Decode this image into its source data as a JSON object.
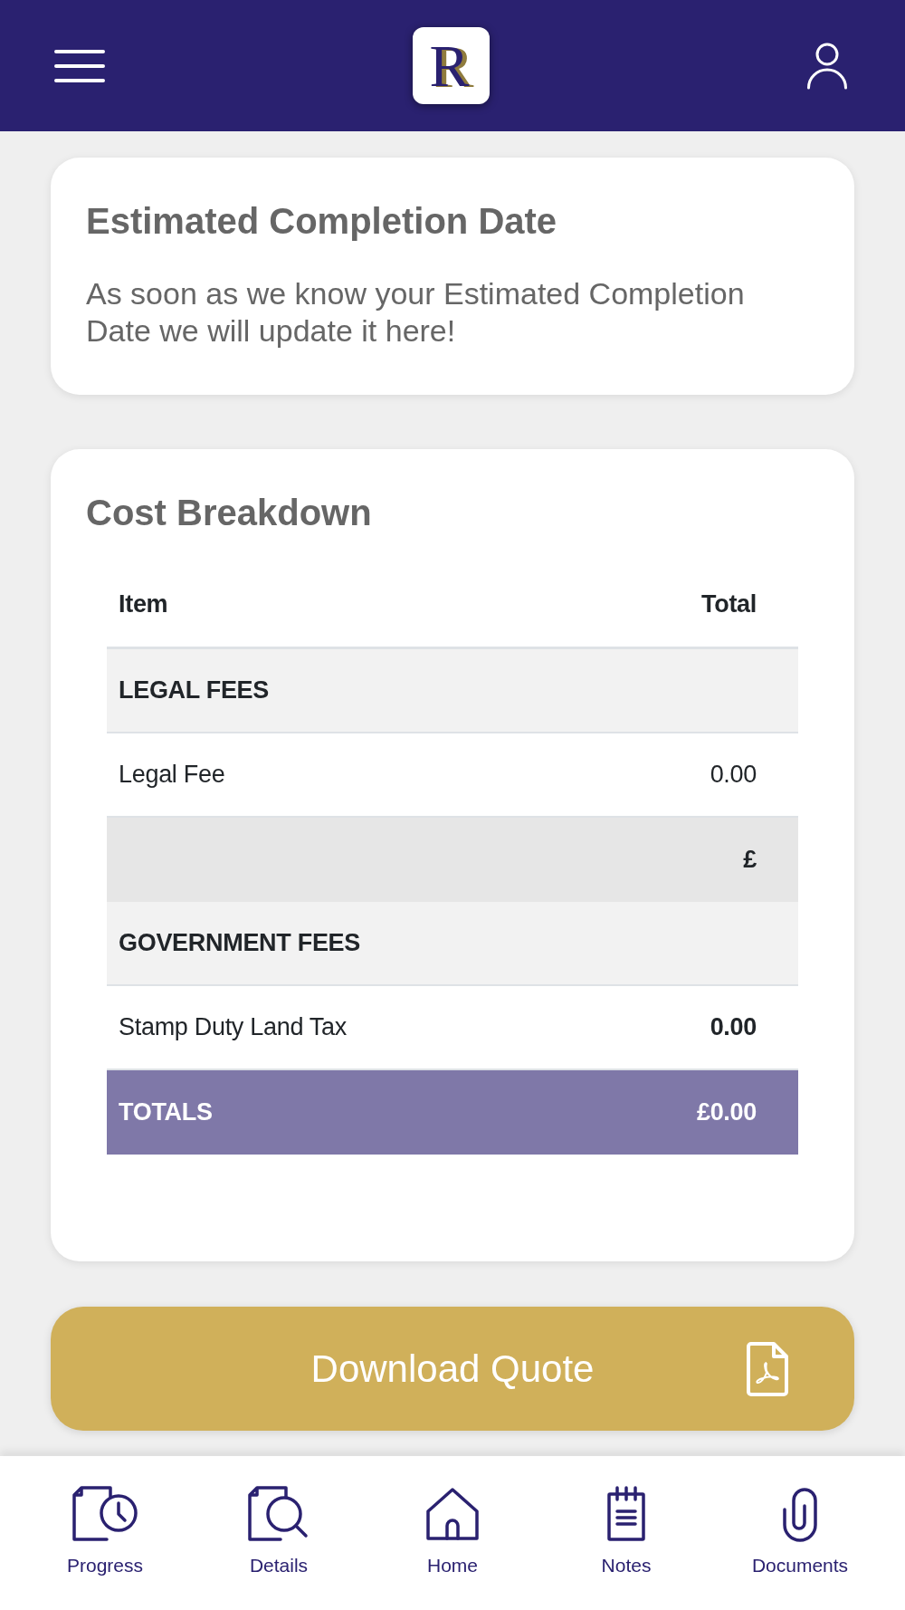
{
  "header": {
    "logo_letter": "R"
  },
  "completion_card": {
    "title": "Estimated Completion Date",
    "message": "As soon as we know your Estimated Completion Date we will update it here!"
  },
  "cost_breakdown": {
    "title": "Cost Breakdown",
    "columns": [
      "Item",
      "Total"
    ],
    "rows": [
      {
        "kind": "section",
        "item": "LEGAL FEES"
      },
      {
        "kind": "line",
        "item": "Legal Fee",
        "total": "0.00",
        "bold": false
      },
      {
        "kind": "subtotal",
        "total": "£"
      },
      {
        "kind": "section",
        "item": "GOVERNMENT FEES"
      },
      {
        "kind": "line",
        "item": "Stamp Duty Land Tax",
        "total": "0.00",
        "bold": true
      },
      {
        "kind": "totals",
        "item": "TOTALS",
        "total": "£0.00"
      }
    ]
  },
  "download_button": {
    "label": "Download Quote"
  },
  "bottom_nav": [
    {
      "label": "Progress"
    },
    {
      "label": "Details"
    },
    {
      "label": "Home"
    },
    {
      "label": "Notes"
    },
    {
      "label": "Documents"
    }
  ]
}
